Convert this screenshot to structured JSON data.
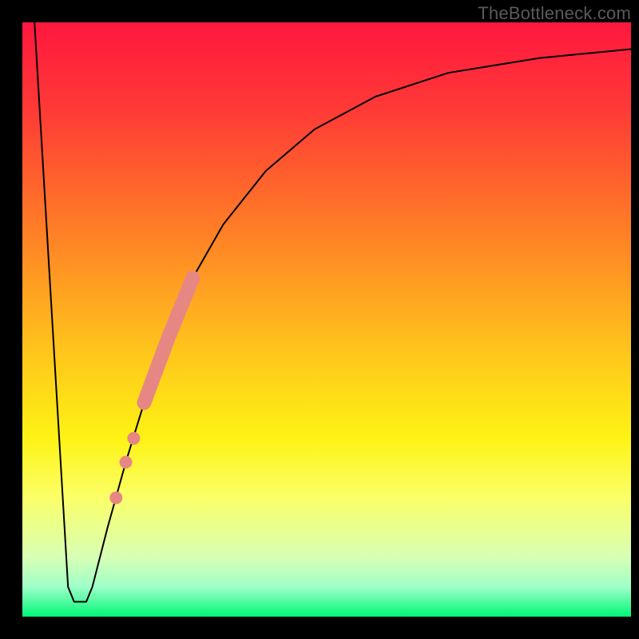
{
  "watermark": "TheBottleneck.com",
  "chart_data": {
    "type": "line",
    "title": "",
    "xlabel": "",
    "ylabel": "",
    "xlim": [
      0,
      100
    ],
    "ylim": [
      0,
      100
    ],
    "grid": false,
    "background_gradient_stops": [
      {
        "offset": 0.0,
        "color": "#ff173e"
      },
      {
        "offset": 0.15,
        "color": "#ff3b36"
      },
      {
        "offset": 0.35,
        "color": "#ff7e26"
      },
      {
        "offset": 0.55,
        "color": "#ffc41c"
      },
      {
        "offset": 0.7,
        "color": "#fef314"
      },
      {
        "offset": 0.8,
        "color": "#fbff68"
      },
      {
        "offset": 0.9,
        "color": "#d7ffb5"
      },
      {
        "offset": 0.95,
        "color": "#9fffc8"
      },
      {
        "offset": 1.0,
        "color": "#00f777"
      }
    ],
    "series": [
      {
        "name": "bottleneck-curve",
        "stroke": "#000000",
        "stroke_width": 2,
        "points": [
          {
            "x": 2.0,
            "y": 100.0
          },
          {
            "x": 7.5,
            "y": 5.0
          },
          {
            "x": 8.5,
            "y": 2.5
          },
          {
            "x": 10.5,
            "y": 2.5
          },
          {
            "x": 11.5,
            "y": 5.0
          },
          {
            "x": 14.0,
            "y": 15.0
          },
          {
            "x": 17.0,
            "y": 26.0
          },
          {
            "x": 20.0,
            "y": 36.0
          },
          {
            "x": 24.0,
            "y": 47.0
          },
          {
            "x": 28.0,
            "y": 57.0
          },
          {
            "x": 33.0,
            "y": 66.0
          },
          {
            "x": 40.0,
            "y": 75.0
          },
          {
            "x": 48.0,
            "y": 82.0
          },
          {
            "x": 58.0,
            "y": 87.5
          },
          {
            "x": 70.0,
            "y": 91.5
          },
          {
            "x": 85.0,
            "y": 94.0
          },
          {
            "x": 100.0,
            "y": 95.5
          }
        ]
      }
    ],
    "highlight_segment": {
      "name": "pink-thick-segment",
      "stroke": "#e78783",
      "stroke_width": 18,
      "points": [
        {
          "x": 20.0,
          "y": 36.0
        },
        {
          "x": 24.0,
          "y": 47.0
        },
        {
          "x": 28.0,
          "y": 57.0
        }
      ]
    },
    "highlight_dots": {
      "name": "pink-dots",
      "fill": "#e78783",
      "radius": 8,
      "points": [
        {
          "x": 18.3,
          "y": 30.0
        },
        {
          "x": 17.0,
          "y": 26.0
        },
        {
          "x": 15.4,
          "y": 20.0
        }
      ]
    }
  }
}
